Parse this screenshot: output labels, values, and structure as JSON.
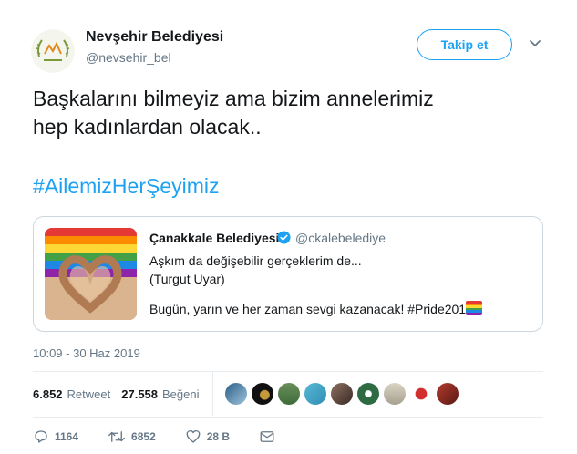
{
  "author": {
    "name": "Nevşehir Belediyesi",
    "handle": "@nevsehir_bel"
  },
  "follow_label": "Takip et",
  "tweet": {
    "line1": "Başkalarını bilmeyiz ama bizim annelerimiz",
    "line2": "hep kadınlardan olacak..",
    "hashtag": "#AilemizHerŞeyimiz"
  },
  "quote": {
    "name": "Çanakkale Belediyesi",
    "handle": "@ckalebelediye",
    "line1": "Aşkım da değişebilir gerçeklerim de...",
    "line2": "(Turgut Uyar)",
    "line3": "Bugün, yarın ve her zaman sevgi kazanacak!  #Pride2019"
  },
  "timestamp": "10:09 - 30 Haz 2019",
  "stats": {
    "retweets_count": "6.852",
    "retweets_label": "Retweet",
    "likes_count": "27.558",
    "likes_label": "Beğeni"
  },
  "actions": {
    "replies": "1164",
    "retweets": "6852",
    "likes": "28 B"
  },
  "colors": {
    "accent": "#1da1f2",
    "muted": "#657786",
    "border": "#e6ecf0",
    "verified": "#1da1f2"
  },
  "icons": {
    "caret": "chevron-down-icon",
    "reply": "reply-icon",
    "retweet": "retweet-icon",
    "like": "heart-icon",
    "dm": "envelope-icon",
    "verified": "verified-badge-icon"
  }
}
